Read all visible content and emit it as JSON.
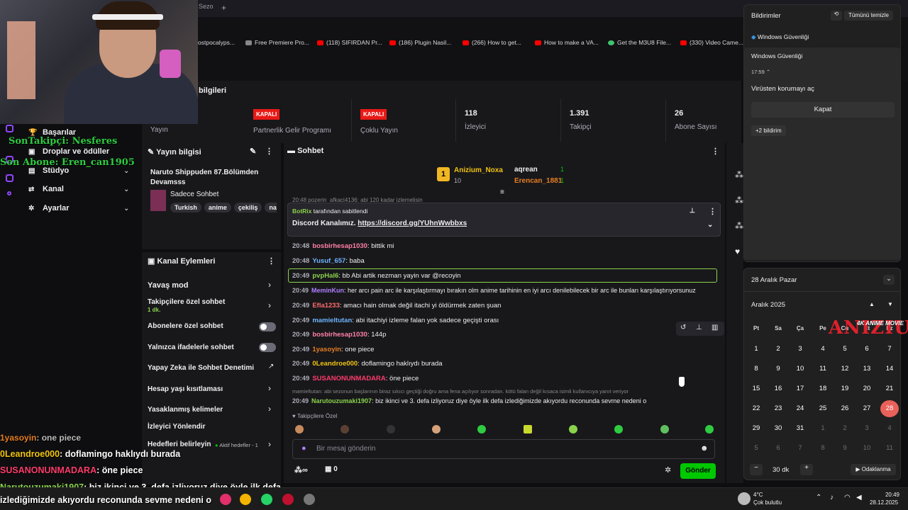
{
  "browser": {
    "tab_label": "Sezo",
    "new_tab": "+",
    "bookmarks": [
      {
        "label": "ostpocalyps...",
        "icon": "page-icon"
      },
      {
        "label": "Free Premiere Pro...",
        "icon": "page-icon"
      },
      {
        "label": "(118) SIFIRDAN Pr...",
        "icon": "youtube-icon"
      },
      {
        "label": "(186) Plugin Nasil...",
        "icon": "youtube-icon"
      },
      {
        "label": "(266) How to get...",
        "icon": "youtube-icon"
      },
      {
        "label": "How to make a VA...",
        "icon": "youtube-icon"
      },
      {
        "label": "Get the M3U8 File...",
        "icon": "green-icon"
      },
      {
        "label": "(330) Video Came...",
        "icon": "youtube-icon"
      }
    ]
  },
  "stats": {
    "title": "bilgileri",
    "items": [
      {
        "value": "",
        "badge": "",
        "label": "Yayın"
      },
      {
        "value": "",
        "badge": "KAPALI",
        "label": "Partnerlik Gelir Programı"
      },
      {
        "value": "",
        "badge": "KAPALI",
        "label": "Çoklu Yayın"
      },
      {
        "value": "118",
        "badge": "",
        "label": "İzleyici"
      },
      {
        "value": "1.391",
        "badge": "",
        "label": "Takipçi"
      },
      {
        "value": "26",
        "badge": "",
        "label": "Abone Sayısı"
      }
    ]
  },
  "sidebar": {
    "items": [
      {
        "label": "Başarılar",
        "icon": "trophy-icon"
      },
      {
        "label": "Droplar ve ödüller",
        "icon": "gift-icon"
      },
      {
        "label": "Stüdyo",
        "icon": "studio-icon"
      },
      {
        "label": "Kanal",
        "icon": "channel-icon"
      },
      {
        "label": "Ayarlar",
        "icon": "gear-icon"
      }
    ]
  },
  "overlays": {
    "last_follower": "SonTakipçi: Nesferes",
    "last_sub": "Son Abone: Eren_can1905",
    "chat": [
      {
        "user": "1yasoyin",
        "text": ": one piece",
        "color": "#e67e22"
      },
      {
        "user": "0Leandroe000",
        "text": ": doflamingo haklıydı burada",
        "color": "#f1c40f"
      },
      {
        "user": "SUSANONUNMADARA",
        "text": ": öne piece",
        "color": "#ff3b6b"
      },
      {
        "user": "Narutouzumaki1907",
        "text": ": biz ikinci ve 3. defa izliyoruz diye öyle ilk defa",
        "color": "#8bd24b"
      },
      {
        "user": "",
        "text": "izlediğimizde akıyordu reconunda sevme nedeni o",
        "color": "#ffffff"
      }
    ]
  },
  "stream_info": {
    "header": "Yayın bilgisi",
    "title": "Naruto Shippuden 87.Bölümden Devamsss",
    "category": "Sadece Sohbet",
    "tags": [
      "Turkish",
      "anime",
      "çekiliş",
      "naru"
    ]
  },
  "channel_actions": {
    "header": "Kanal Eylemleri",
    "items": [
      {
        "label": "Yavaş mod",
        "sub": "",
        "control": "chevron"
      },
      {
        "label": "Takipçilere özel sohbet",
        "sub": "1 dk.",
        "control": "chevron"
      },
      {
        "label": "Abonelere özel sohbet",
        "sub": "",
        "control": "toggle"
      },
      {
        "label": "Yalnızca ifadelerle sohbet",
        "sub": "",
        "control": "toggle"
      },
      {
        "label": "Yapay Zeka ile Sohbet Denetimi",
        "sub": "",
        "control": "external"
      },
      {
        "label": "Hesap yaşı kısıtlaması",
        "sub": "",
        "control": "chevron"
      },
      {
        "label": "Yasaklanmış kelimeler",
        "sub": "",
        "control": "chevron"
      },
      {
        "label": "İzleyici Yönlendir",
        "sub": "",
        "control": "none"
      },
      {
        "label": "Hedefleri belirleyin",
        "sub": "Aktif hedefler - 1",
        "control": "chevron"
      }
    ]
  },
  "chat": {
    "header": "Sohbet",
    "leaderboard": [
      {
        "rank": "1",
        "user": "Anizium_Noxa",
        "points": "10"
      },
      {
        "rank": "",
        "user": "aqrean",
        "points": "1"
      },
      {
        "rank": "",
        "user": "Erencan_1881",
        "points": "1"
      }
    ],
    "cut_line": "20:48 pozerin_afkaci4136: abi 120 kadar izlemelisin",
    "pinned_by": "BotRix",
    "pinned_suffix": "tarafından sabitlendi",
    "pinned_text": "Discord Kanalımız.",
    "pinned_link": "https://discord.gg/YUhnWwbbxs",
    "messages": [
      {
        "time": "20:48",
        "user": "bosbirhesap1030",
        "text": ": bittik mi",
        "color": "#ff7fa8"
      },
      {
        "time": "20:48",
        "user": "Yusuf_657",
        "text": ": baba",
        "color": "#6fb4ff"
      },
      {
        "time": "20:49",
        "user": "pvpHal6",
        "text": ": bb Abi artik nezman yayin var @recoyin",
        "color": "#8bd24b"
      },
      {
        "time": "20:49",
        "user": "MeminKun",
        "text": ": her arcı pain arc ile karşılaştırmayı bırakın olm anime tarihinin en iyi arcı denilebilecek bir arc ile bunları karşılaştırıyorsunuz",
        "color": "#b07fff"
      },
      {
        "time": "20:49",
        "user": "Efla1233",
        "text": ": amacı hain olmak değil itachi yi öldürmek zaten şuan",
        "color": "#ff6b6b"
      },
      {
        "time": "20:49",
        "user": "mamieltutan",
        "text": ": abi itachiyi izleme falan yok sadece geçişti orası",
        "color": "#6fb4ff"
      },
      {
        "time": "20:49",
        "user": "bosbirhesap1030",
        "text": ": 144p",
        "color": "#ff7fa8"
      },
      {
        "time": "20:49",
        "user": "1yasoyin",
        "text": ": one piece",
        "color": "#e67e22"
      },
      {
        "time": "20:49",
        "user": "0Leandroe000",
        "text": ": doflamingo haklıydı burada",
        "color": "#f1c40f"
      },
      {
        "time": "20:49",
        "user": "SUSANONUNMADARA",
        "text": ": öne piece",
        "color": "#ff3b6b"
      },
      {
        "time": "20:49",
        "user": "Narutouzumaki1907",
        "text": ": biz ikinci ve 3. defa izliyoruz diye öyle ilk defa izlediğimizde akıyordu reconunda sevme nedeni o",
        "color": "#8bd24b"
      }
    ],
    "reply_context": "mamieltutan: abi sezonun başlarının biraz sıkıcı geçtiği doğru ama fena açılıyor sonradan. kötü falan değil kısaca isimli kullanıcıya yanıt veriyor",
    "followers_only": "Takipçilere Özel",
    "input_placeholder": "Bir mesaj gönderin",
    "points": "0",
    "send_label": "Gönder"
  },
  "notifications": {
    "title": "Bildirimler",
    "clear_all": "Tümünü temizle",
    "app": "Windows Güvenliği",
    "group": "Windows Güvenliği",
    "time": "17:59",
    "message": "Virüsten korumayı aç",
    "action": "Kapat",
    "more": "+2 bildirim"
  },
  "calendar": {
    "date_header": "28 Aralık Pazar",
    "month": "Aralık 2025",
    "weekdays": [
      "Pt",
      "Sa",
      "Ça",
      "Pe",
      "Cu",
      "Ct",
      "Pz"
    ],
    "weeks": [
      [
        "1",
        "2",
        "3",
        "4",
        "5",
        "6",
        "7"
      ],
      [
        "8",
        "9",
        "10",
        "11",
        "12",
        "13",
        "14"
      ],
      [
        "15",
        "16",
        "17",
        "18",
        "19",
        "20",
        "21"
      ],
      [
        "22",
        "23",
        "24",
        "25",
        "26",
        "27",
        "28"
      ],
      [
        "29",
        "30",
        "31",
        "1",
        "2",
        "3",
        "4"
      ],
      [
        "5",
        "6",
        "7",
        "8",
        "9",
        "10",
        "11"
      ]
    ],
    "today": "28",
    "focus_minutes": "30 dk",
    "focus_label": "Odaklanma"
  },
  "watermark": {
    "brand": "ANIZIUM",
    "sub": "4K ANIME MOVIE"
  },
  "taskbar": {
    "weather_temp": "4°C",
    "weather_text": "Çok bulutlu",
    "time": "20:49",
    "date": "28.12.2025"
  },
  "colors": {
    "accent": "#9147ff",
    "live_red": "#e91916",
    "send_green": "#00c800",
    "today": "#e8615a"
  }
}
